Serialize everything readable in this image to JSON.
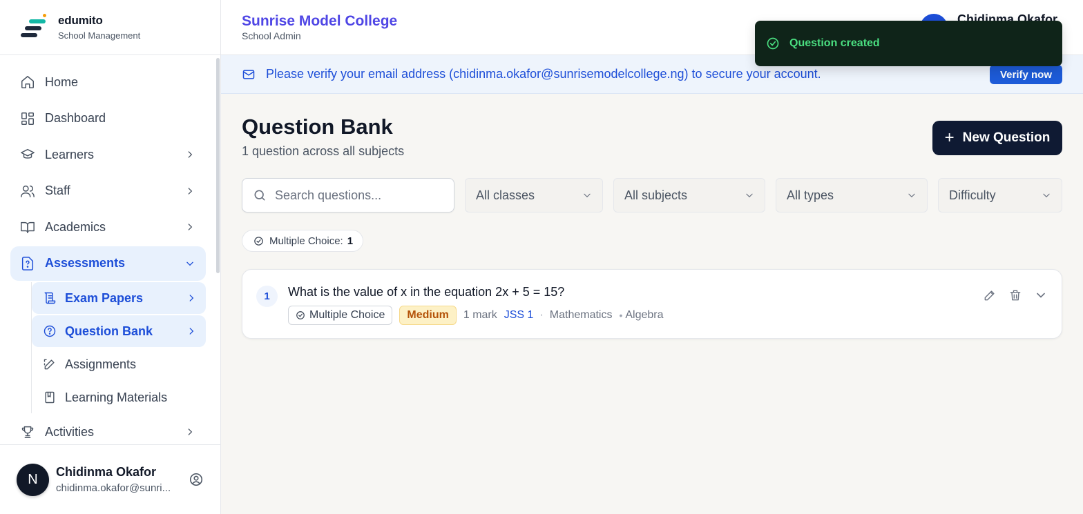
{
  "brand": {
    "name": "edumito",
    "tagline": "School Management",
    "logo_colors": [
      "#1e293b",
      "#14b8a6",
      "#f59e0b"
    ]
  },
  "sidebar": {
    "items": [
      {
        "label": "Home",
        "icon": "home-icon",
        "has_chevron": false
      },
      {
        "label": "Dashboard",
        "icon": "dashboard-icon",
        "has_chevron": false
      },
      {
        "label": "Learners",
        "icon": "graduation-cap-icon",
        "has_chevron": true
      },
      {
        "label": "Staff",
        "icon": "users-icon",
        "has_chevron": true
      },
      {
        "label": "Academics",
        "icon": "book-open-icon",
        "has_chevron": true
      },
      {
        "label": "Assessments",
        "icon": "file-question-icon",
        "has_chevron": true,
        "expanded": true,
        "active": true
      },
      {
        "label": "Activities",
        "icon": "trophy-icon",
        "has_chevron": true
      }
    ],
    "assessments_sub": [
      {
        "label": "Exam Papers",
        "icon": "scroll-icon",
        "selected": true
      },
      {
        "label": "Question Bank",
        "icon": "question-circle-icon",
        "selected": true
      },
      {
        "label": "Assignments",
        "icon": "edit-icon",
        "selected": false
      },
      {
        "label": "Learning Materials",
        "icon": "book-icon",
        "selected": false
      }
    ],
    "user": {
      "initial": "N",
      "name": "Chidinma Okafor",
      "email": "chidinma.okafor@sunri..."
    }
  },
  "header": {
    "school_name": "Sunrise Model College",
    "role": "School Admin",
    "user_name": "Chidinma Okafor"
  },
  "toast": {
    "message": "Question created"
  },
  "banner": {
    "message": "Please verify your email address (chidinma.okafor@sunrisemodelcollege.ng) to secure your account.",
    "action": "Verify now"
  },
  "main": {
    "title": "Question Bank",
    "subtitle": "1 question across all subjects",
    "new_button": "New Question",
    "search_placeholder": "Search questions...",
    "filters": [
      "All classes",
      "All subjects",
      "All types",
      "Difficulty"
    ],
    "type_chip": {
      "label": "Multiple Choice:",
      "count": "1"
    },
    "questions": [
      {
        "number": "1",
        "text": "What is the value of x in the equation 2x + 5 = 15?",
        "type": "Multiple Choice",
        "difficulty": "Medium",
        "marks": "1 mark",
        "class": "JSS 1",
        "subject": "Mathematics",
        "topic": "Algebra"
      }
    ]
  },
  "colors": {
    "accent": "#1d4ed8",
    "school_name": "#4f46e5",
    "primary_button": "#0f1a33",
    "toast_bg": "#0f2419",
    "toast_text": "#4ade80",
    "difficulty_medium": "#b45309"
  }
}
